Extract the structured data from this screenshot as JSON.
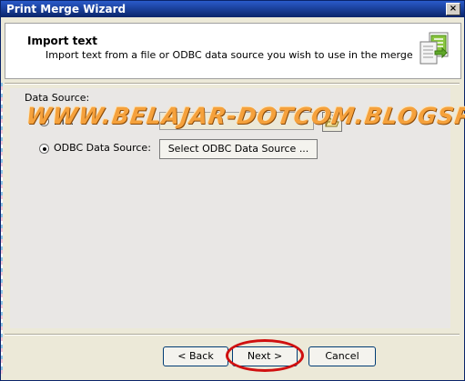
{
  "window": {
    "title": "Print Merge Wizard",
    "close_label": "×"
  },
  "header": {
    "title": "Import text",
    "description": "Import text from a file or ODBC data source you wish to use in the merge",
    "icon": "document-import-icon"
  },
  "data_source": {
    "label": "Data Source:",
    "options": [
      {
        "label": "File:",
        "checked": false
      },
      {
        "label": "ODBC Data Source:",
        "checked": true
      }
    ],
    "file_value": "",
    "browse_icon": "folder-open-icon",
    "select_odbc_label": "Select ODBC Data Source ..."
  },
  "watermark": "WWW.BELAJAR-DOTCOM.BLOGSPOT.COM",
  "footer": {
    "back_label": "< Back",
    "next_label": "Next >",
    "cancel_label": "Cancel"
  },
  "colors": {
    "title_bar": "#0a246a",
    "watermark": "#f5a13c",
    "highlight": "#d01010"
  }
}
